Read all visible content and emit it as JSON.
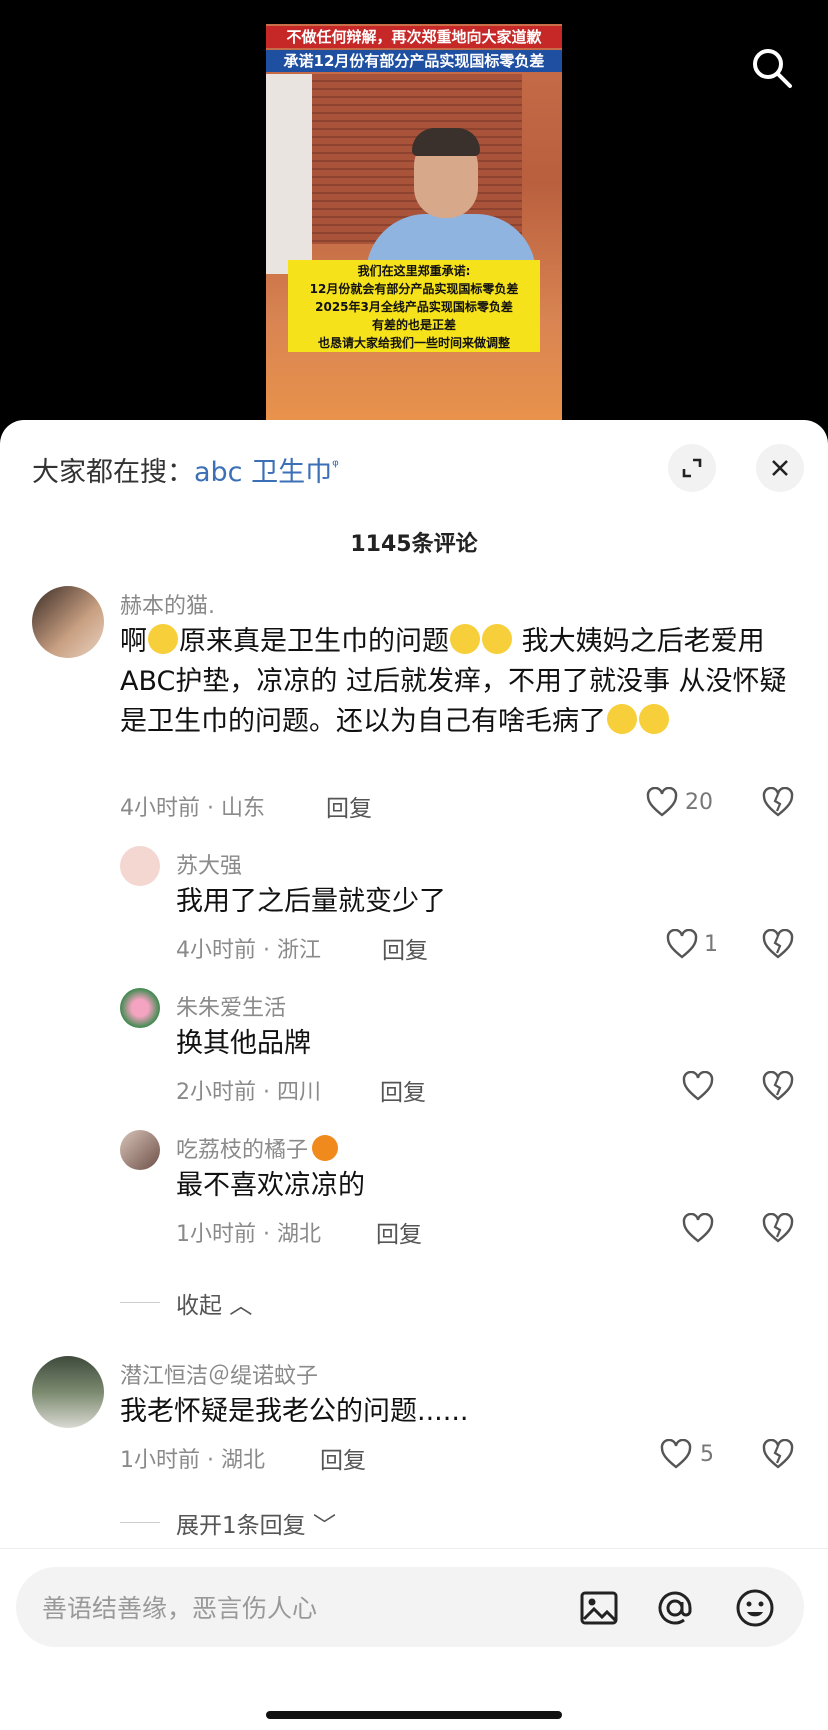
{
  "video": {
    "caption_top": "不做任何辩解，再次郑重地向大家道歉",
    "caption_bottom": "承诺12月份有部分产品实现国标零负差",
    "subtitle_lines": [
      "我们在这里郑重承诺:",
      "12月份就会有部分产品实现国标零负差",
      "2025年3月全线产品实现国标零负差",
      "有差的也是正差",
      "也恳请大家给我们一些时间来做调整"
    ]
  },
  "sheet": {
    "trend_prefix": "大家都在搜：",
    "trend_keyword": "abc 卫生巾",
    "comment_count": "1145条评论"
  },
  "comments": [
    {
      "name": "赫本的猫.",
      "text_a": "啊",
      "text_b": "原来真是卫生巾的问题",
      "text_c": " 我大姨妈之后老爱用ABC护垫，凉凉的 过后就发痒，不用了就没事 从没怀疑是卫生巾的问题。还以为自己有啥毛病了",
      "meta": "4小时前 · 山东",
      "reply": "回复",
      "likes": "20"
    },
    {
      "name": "苏大强",
      "text": "我用了之后量就变少了",
      "meta": "4小时前 · 浙江",
      "reply": "回复",
      "likes": "1"
    },
    {
      "name": "朱朱爱生活",
      "text": "换其他品牌",
      "meta": "2小时前 · 四川",
      "reply": "回复",
      "likes": ""
    },
    {
      "name": "吃荔枝的橘子",
      "text": "最不喜欢凉凉的",
      "meta": "1小时前 · 湖北",
      "reply": "回复",
      "likes": ""
    },
    {
      "name": "潜江恒洁＠缇诺蚊子",
      "text": "我老怀疑是我老公的问题......",
      "meta": "1小时前 · 湖北",
      "reply": "回复",
      "likes": "5"
    }
  ],
  "collapse_label": "收起",
  "expand_label": "展开1条回复",
  "input": {
    "placeholder": "善语结善缘，恶言伤人心"
  }
}
